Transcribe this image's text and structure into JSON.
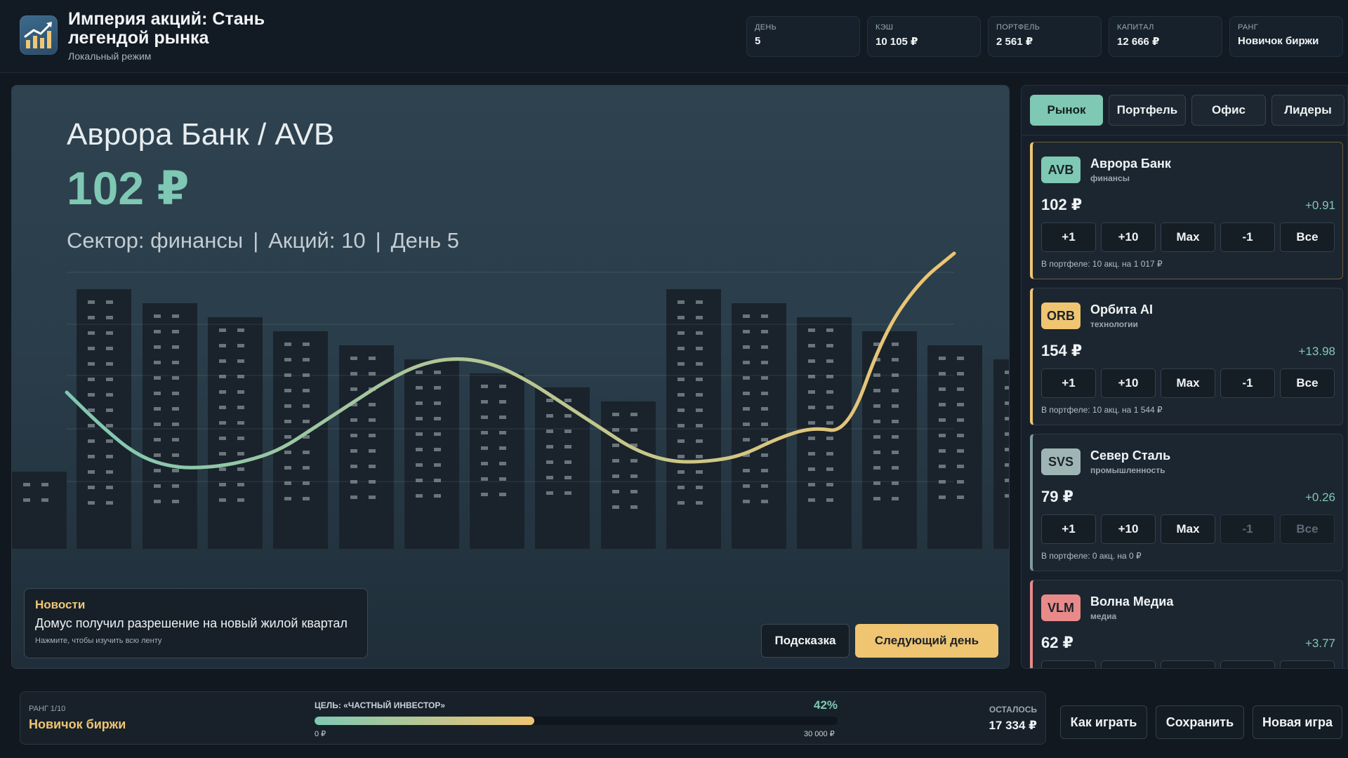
{
  "app": {
    "title": "Империя акций: Стань легендой рынка",
    "subtitle": "Локальный режим"
  },
  "stats": [
    {
      "label": "ДЕНЬ",
      "value": "5"
    },
    {
      "label": "КЭШ",
      "value": "10 105 ₽"
    },
    {
      "label": "ПОРТФЕЛЬ",
      "value": "2 561 ₽"
    },
    {
      "label": "КАПИТАЛ",
      "value": "12 666 ₽"
    },
    {
      "label": "РАНГ",
      "value": "Новичок биржи"
    }
  ],
  "selected_stock": {
    "title": "Аврора Банк / AVB",
    "price": "102 ₽",
    "sector": "Сектор: финансы",
    "shares": "Акций: 10",
    "day": "День 5"
  },
  "chart_data": {
    "type": "line",
    "series": [
      {
        "values": [
          92,
          89,
          86.5,
          85.5,
          85.5,
          86,
          87,
          89,
          91,
          93,
          94.5,
          95,
          94.5,
          93,
          91,
          89,
          87,
          86,
          86,
          86.5,
          88,
          89,
          88.5,
          97,
          101.5,
          104
        ]
      }
    ],
    "ylim": [
      70,
      110
    ],
    "colors": {
      "start": "#7fc8b3",
      "end": "#efc572"
    }
  },
  "news": {
    "title": "Новости",
    "text": "Домус получил разрешение на новый жилой квартал",
    "hint": "Нажмите, чтобы изучить всю ленту"
  },
  "controls": {
    "hint_label": "Подсказка",
    "next_day_label": "Следующий день"
  },
  "tabs": [
    {
      "label": "Рынок",
      "active": true
    },
    {
      "label": "Портфель",
      "active": false
    },
    {
      "label": "Офис",
      "active": false
    },
    {
      "label": "Лидеры",
      "active": false
    }
  ],
  "market": [
    {
      "ticker": "AVB",
      "name": "Аврора Банк",
      "sector": "финансы",
      "price": "102 ₽",
      "change": "+0.91",
      "holding": "В портфеле: 10 акц. на 1 017 ₽",
      "ticker_color": "#7fc8b3",
      "accent": "#efc572",
      "highlight": true,
      "can_sell": true
    },
    {
      "ticker": "ORB",
      "name": "Орбита AI",
      "sector": "технологии",
      "price": "154 ₽",
      "change": "+13.98",
      "holding": "В портфеле: 10 акц. на 1 544 ₽",
      "ticker_color": "#efc572",
      "accent": "#efc572",
      "highlight": false,
      "can_sell": true
    },
    {
      "ticker": "SVS",
      "name": "Север Сталь",
      "sector": "промышленность",
      "price": "79 ₽",
      "change": "+0.26",
      "holding": "В портфеле: 0 акц. на 0 ₽",
      "ticker_color": "#9fb5b5",
      "accent": "#7f9aa2",
      "highlight": false,
      "can_sell": false
    },
    {
      "ticker": "VLM",
      "name": "Волна Медиа",
      "sector": "медиа",
      "price": "62 ₽",
      "change": "+3.77",
      "holding": "",
      "ticker_color": "#e88a8a",
      "accent": "#e88a8a",
      "highlight": false,
      "can_sell": true
    }
  ],
  "trade_buttons": [
    "+1",
    "+10",
    "Max",
    "-1",
    "Все"
  ],
  "goal": {
    "rank_label": "РАНГ 1/10",
    "rank_value": "Новичок биржи",
    "label": "ЦЕЛЬ: «ЧАСТНЫЙ ИНВЕСТОР»",
    "percent_text": "42%",
    "progress": 0.42,
    "min": "0 ₽",
    "max": "30 000 ₽",
    "left_label": "ОСТАЛОСЬ",
    "left_value": "17 334 ₽"
  },
  "actions": [
    "Как играть",
    "Сохранить",
    "Новая игра"
  ]
}
